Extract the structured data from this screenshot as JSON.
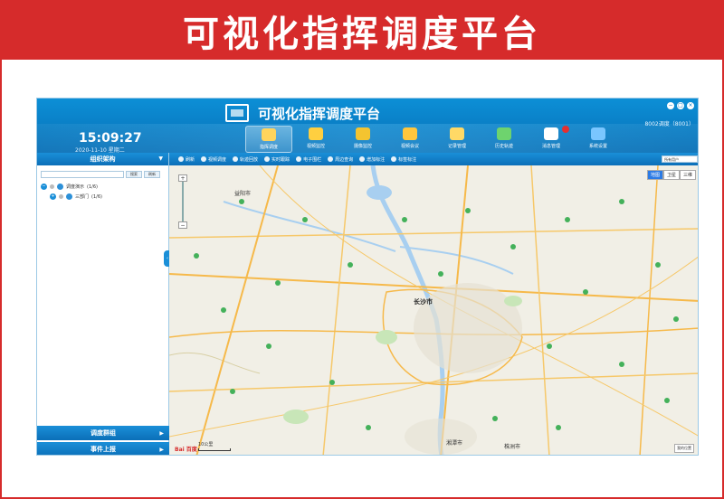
{
  "banner": {
    "title": "可视化指挥调度平台"
  },
  "app": {
    "title": "可视化指挥调度平台",
    "user": "8002调度（8001）",
    "clock": "15:09:27",
    "date": "2020-11-10 星期二",
    "window_controls": [
      "−",
      "□",
      "×"
    ]
  },
  "menu": [
    {
      "label": "指挥调度",
      "icon": "command-icon",
      "color": "#ffd45c",
      "active": true
    },
    {
      "label": "视频监控",
      "icon": "camera-icon",
      "color": "#ffcf40"
    },
    {
      "label": "摄像监控",
      "icon": "cctv-icon",
      "color": "#f4c430"
    },
    {
      "label": "视频会议",
      "icon": "conference-icon",
      "color": "#ffc63d"
    },
    {
      "label": "记录管理",
      "icon": "record-icon",
      "color": "#ffd966"
    },
    {
      "label": "历史轨迹",
      "icon": "globe-icon",
      "color": "#6ed36e"
    },
    {
      "label": "消息管理",
      "icon": "message-icon",
      "color": "#ffffff",
      "badge": true
    },
    {
      "label": "系统设置",
      "icon": "settings-icon",
      "color": "#7ac6ff"
    }
  ],
  "sidebar": {
    "header": "组织架构",
    "search_placeholder": "",
    "search_button": "搜索",
    "reset_button": "刷新",
    "tree": [
      {
        "label": "调度演示",
        "count": "(1/6)"
      },
      {
        "label": "三部门",
        "count": "(1/6)"
      }
    ],
    "bottom_1": "调度群组",
    "bottom_2": "事件上报"
  },
  "toolbar": {
    "tools": [
      {
        "label": "刷新",
        "icon": "refresh-icon"
      },
      {
        "label": "视频调度",
        "icon": "video-dispatch-icon"
      },
      {
        "label": "轨迹回放",
        "icon": "track-icon"
      },
      {
        "label": "实时跟踪",
        "icon": "tracking-icon"
      },
      {
        "label": "电子围栏",
        "icon": "fence-icon"
      },
      {
        "label": "周边查询",
        "icon": "nearby-icon"
      },
      {
        "label": "增加标注",
        "icon": "annotate-icon"
      },
      {
        "label": "标签标注",
        "icon": "tag-icon"
      }
    ],
    "layer_select": "所有用户"
  },
  "map": {
    "type_buttons": [
      "地图",
      "卫星",
      "三维"
    ],
    "scale": "10公里",
    "logo": "Bai 百度",
    "corner_label": "我的位置",
    "cities": [
      "益阳市",
      "长沙市",
      "湘潭市",
      "株洲市"
    ]
  }
}
